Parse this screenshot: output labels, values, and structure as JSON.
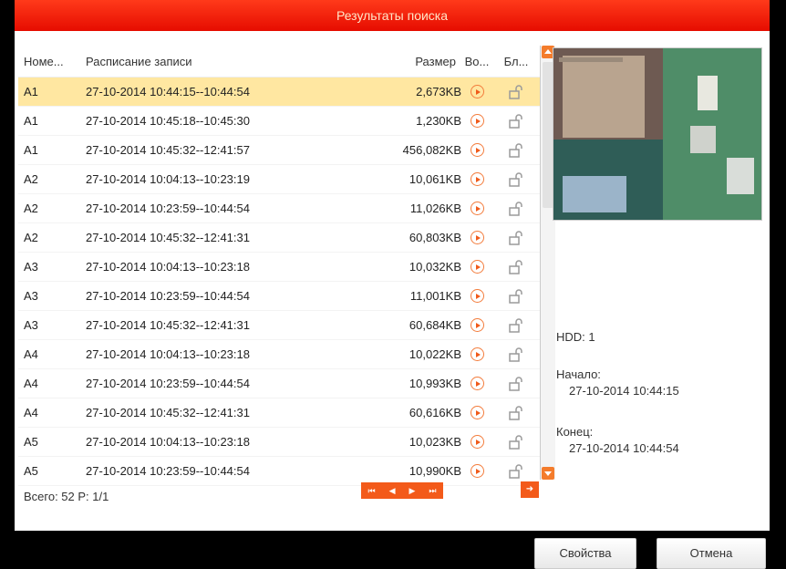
{
  "window": {
    "title": "Результаты поиска"
  },
  "table": {
    "headers": {
      "num": "Номе...",
      "schedule": "Расписание записи",
      "size": "Размер",
      "play": "Во...",
      "lock": "Бл..."
    },
    "rows": [
      {
        "num": "A1",
        "schedule": "27-10-2014 10:44:15--10:44:54",
        "size": "2,673KB"
      },
      {
        "num": "A1",
        "schedule": "27-10-2014 10:45:18--10:45:30",
        "size": "1,230KB"
      },
      {
        "num": "A1",
        "schedule": "27-10-2014 10:45:32--12:41:57",
        "size": "456,082KB"
      },
      {
        "num": "A2",
        "schedule": "27-10-2014 10:04:13--10:23:19",
        "size": "10,061KB"
      },
      {
        "num": "A2",
        "schedule": "27-10-2014 10:23:59--10:44:54",
        "size": "11,026KB"
      },
      {
        "num": "A2",
        "schedule": "27-10-2014 10:45:32--12:41:31",
        "size": "60,803KB"
      },
      {
        "num": "A3",
        "schedule": "27-10-2014 10:04:13--10:23:18",
        "size": "10,032KB"
      },
      {
        "num": "A3",
        "schedule": "27-10-2014 10:23:59--10:44:54",
        "size": "11,001KB"
      },
      {
        "num": "A3",
        "schedule": "27-10-2014 10:45:32--12:41:31",
        "size": "60,684KB"
      },
      {
        "num": "A4",
        "schedule": "27-10-2014 10:04:13--10:23:18",
        "size": "10,022KB"
      },
      {
        "num": "A4",
        "schedule": "27-10-2014 10:23:59--10:44:54",
        "size": "10,993KB"
      },
      {
        "num": "A4",
        "schedule": "27-10-2014 10:45:32--12:41:31",
        "size": "60,616KB"
      },
      {
        "num": "A5",
        "schedule": "27-10-2014 10:04:13--10:23:18",
        "size": "10,023KB"
      },
      {
        "num": "A5",
        "schedule": "27-10-2014 10:23:59--10:44:54",
        "size": "10,990KB"
      }
    ]
  },
  "footer": {
    "summary": "Всего: 52  P: 1/1"
  },
  "details": {
    "hdd": "HDD: 1",
    "start_label": "Начало:",
    "start_value": "27-10-2014 10:44:15",
    "end_label": "Конец:",
    "end_value": "27-10-2014 10:44:54"
  },
  "buttons": {
    "properties": "Свойства",
    "cancel": "Отмена"
  },
  "colors": {
    "accent": "#f35a1a",
    "selected_row": "#ffe7a1",
    "title_bar": "#e60c00"
  }
}
